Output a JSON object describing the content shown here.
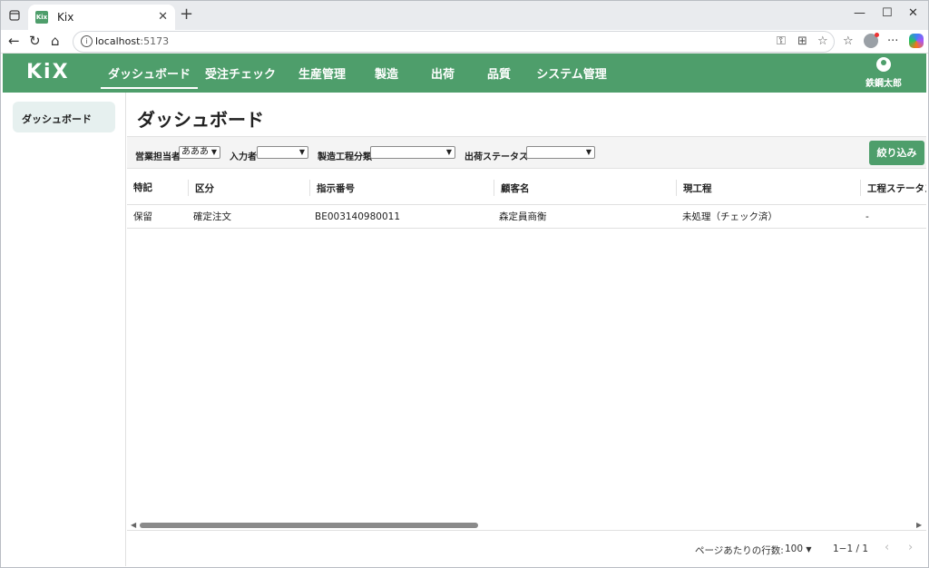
{
  "browser": {
    "tab_title": "Kix",
    "favicon_text": "Kix",
    "new_tab": "+",
    "url_host": "localhost",
    "url_port": ":5173"
  },
  "app": {
    "logo": "KiX",
    "nav": [
      {
        "label": "ダッシュボード",
        "active": true
      },
      {
        "label": "受注チェック"
      },
      {
        "label": "生産管理"
      },
      {
        "label": "製造"
      },
      {
        "label": "出荷"
      },
      {
        "label": "品質"
      },
      {
        "label": "システム管理"
      }
    ],
    "user_name": "鉄鋼太郎"
  },
  "sidebar": {
    "items": [
      {
        "label": "ダッシュボード"
      }
    ]
  },
  "page": {
    "title": "ダッシュボード"
  },
  "filters": {
    "sales_rep_label": "営業担当者",
    "sales_rep_value": "あああ",
    "entered_by_label": "入力者",
    "entered_by_value": "",
    "process_class_label": "製造工程分類",
    "process_class_value": "",
    "shipping_status_label": "出荷ステータス",
    "shipping_status_value": "",
    "submit_label": "絞り込み"
  },
  "table": {
    "columns": [
      "特記",
      "区分",
      "指示番号",
      "顧客名",
      "現工程",
      "工程ステータス"
    ],
    "rows": [
      [
        "保留",
        "確定注文",
        "BE003140980011",
        "森定員商衡",
        "未処理（チェック済）",
        "-"
      ]
    ]
  },
  "pagination": {
    "rows_per_page_label": "ページあたりの行数:",
    "rows_per_page_value": "100",
    "range": "1−1 / 1"
  },
  "colors": {
    "brand": "#4e9e6b",
    "sidebar_active": "#e6f0ef"
  }
}
